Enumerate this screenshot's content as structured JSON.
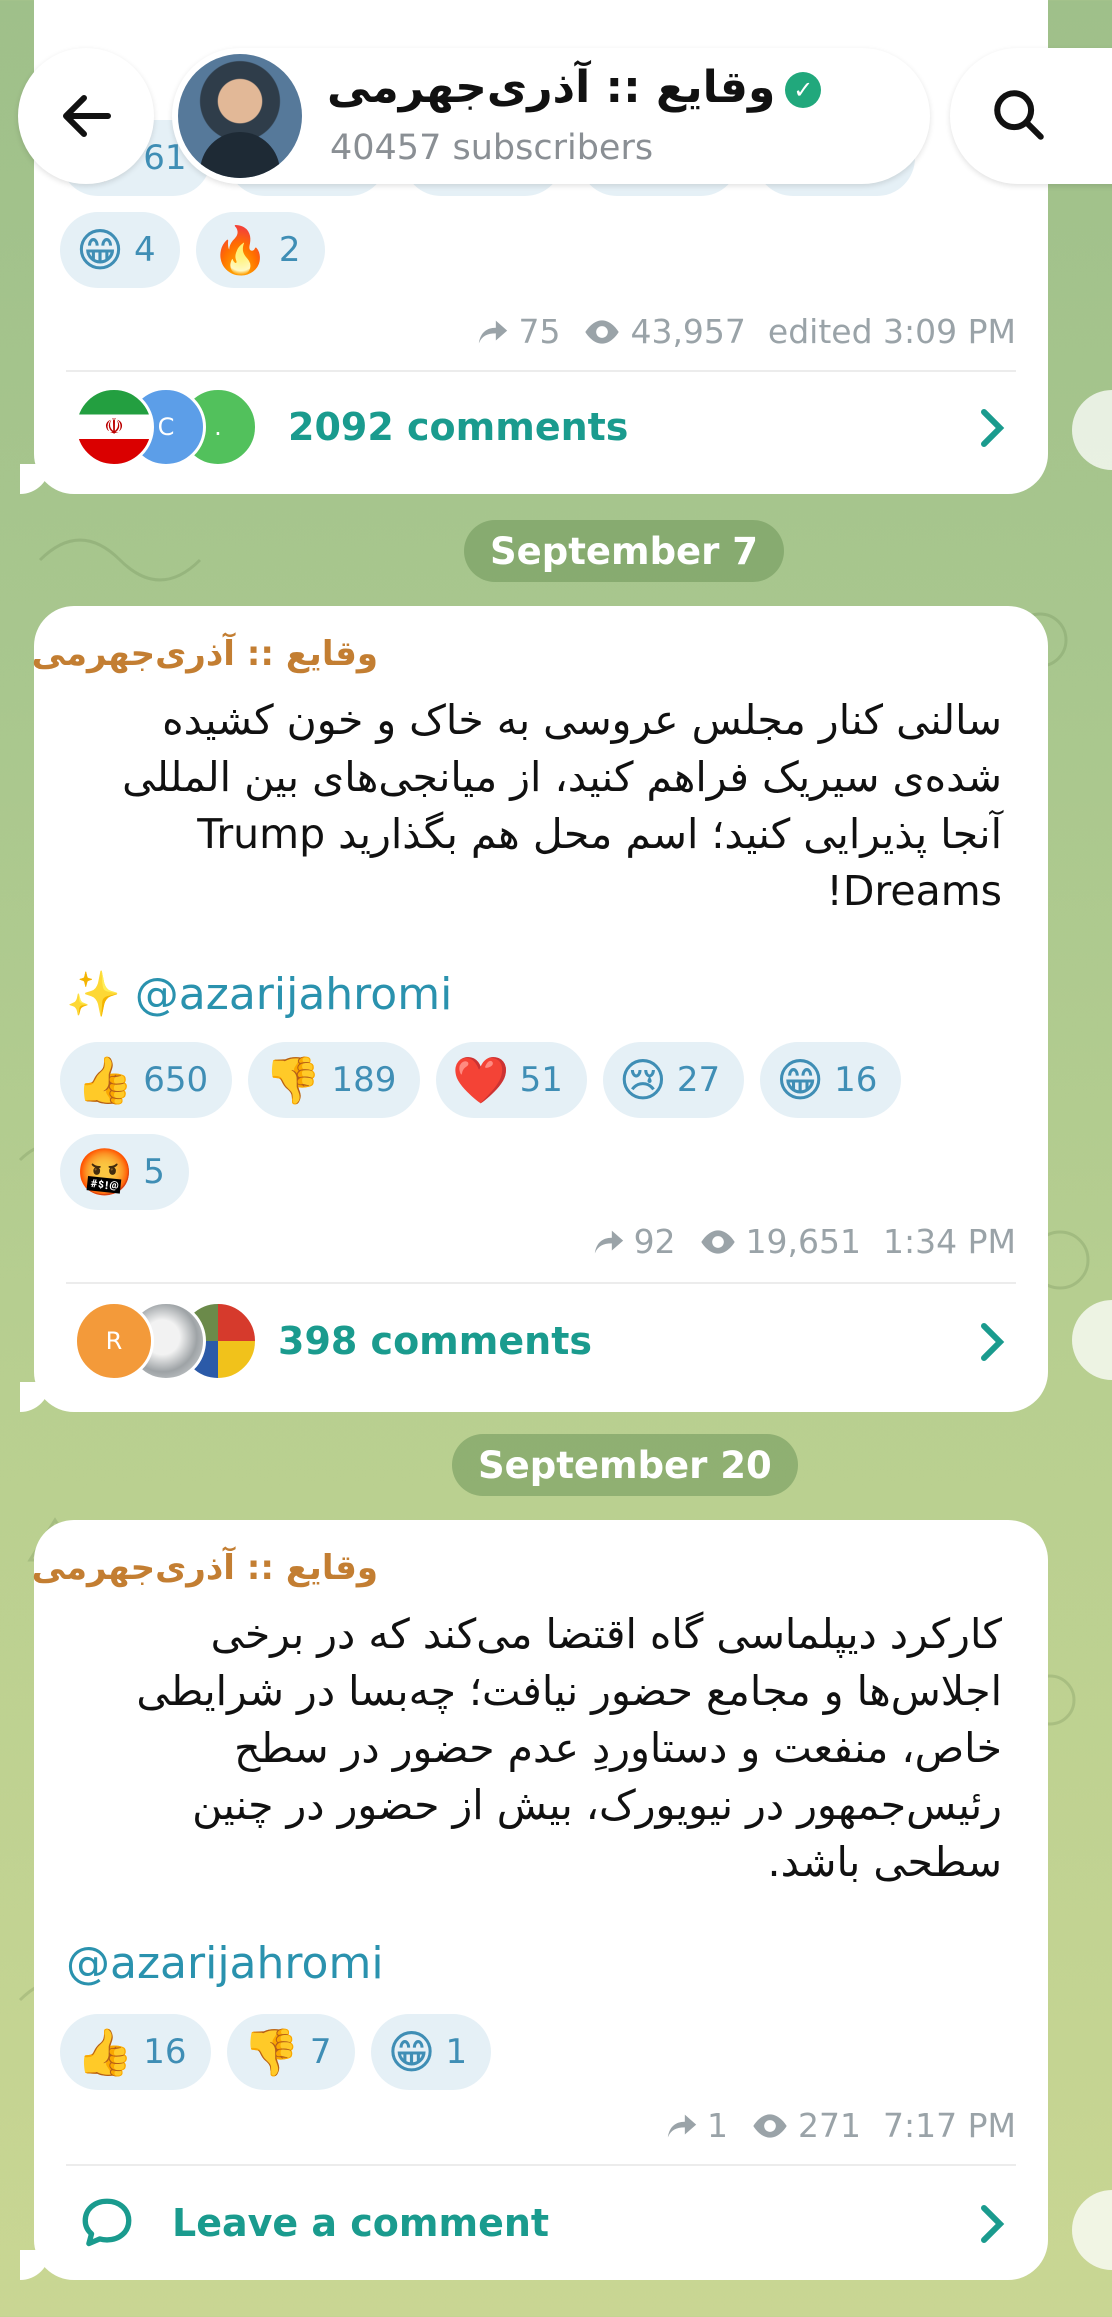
{
  "header": {
    "channel_name": "وقایع :: آذری‌جهرمی",
    "subscribers": "40457 subscribers"
  },
  "post1": {
    "partial_reaction_count": "61",
    "reactions": [
      {
        "emoji": "😁",
        "count": "4"
      },
      {
        "emoji": "🔥",
        "count": "2"
      }
    ],
    "forwards": "75",
    "views": "43,957",
    "time": "edited 3:09 PM",
    "commenter_initials": [
      "C",
      "."
    ],
    "comments": "2092 comments"
  },
  "date1": "September 7",
  "post2": {
    "author": "وقایع :: آذری‌جهرمی",
    "text_lines": [
      "سالنی کنار مجلس عروسی به خاک و خون کشیده",
      "شده‌ی سیریک فراهم کنید، از میانجی‌های بین المللی",
      "آنجا پذیرایی کنید؛ اسم محل هم بگذارید Trump",
      "Dreams!"
    ],
    "handle": "✨ @azarijahromi",
    "reactions": [
      {
        "emoji": "👍",
        "count": "650"
      },
      {
        "emoji": "👎",
        "count": "189"
      },
      {
        "emoji": "❤️",
        "count": "51"
      },
      {
        "emoji": "😢",
        "count": "27"
      },
      {
        "emoji": "😁",
        "count": "16"
      },
      {
        "emoji": "🤬",
        "count": "5"
      }
    ],
    "forwards": "92",
    "views": "19,651",
    "time": "1:34 PM",
    "commenter_initials": [
      "R"
    ],
    "comments": "398 comments"
  },
  "date2": "September 20",
  "post3": {
    "author": "وقایع :: آذری‌جهرمی",
    "text_lines": [
      "کارکرد دیپلماسی گاه اقتضا می‌کند که در برخی",
      "اجلاس‌ها و مجامع حضور نیافت؛ چه‌بسا در شرایطی",
      "خاص، منفعت و دستاوردِ عدم حضور در سطح",
      "رئیس‌جمهور در نیویورک، بیش از حضور در چنین",
      "سطحی باشد."
    ],
    "handle": "@azarijahromi",
    "reactions": [
      {
        "emoji": "👍",
        "count": "16"
      },
      {
        "emoji": "👎",
        "count": "7"
      },
      {
        "emoji": "😁",
        "count": "1"
      }
    ],
    "forwards": "1",
    "views": "271",
    "time": "7:17 PM",
    "comments": "Leave a comment"
  },
  "colors": {
    "accent_teal": "#1a9b8e",
    "author_orange": "#c37e32",
    "reaction_bg": "#e5f0f6",
    "reaction_text": "#3f8eb5"
  }
}
